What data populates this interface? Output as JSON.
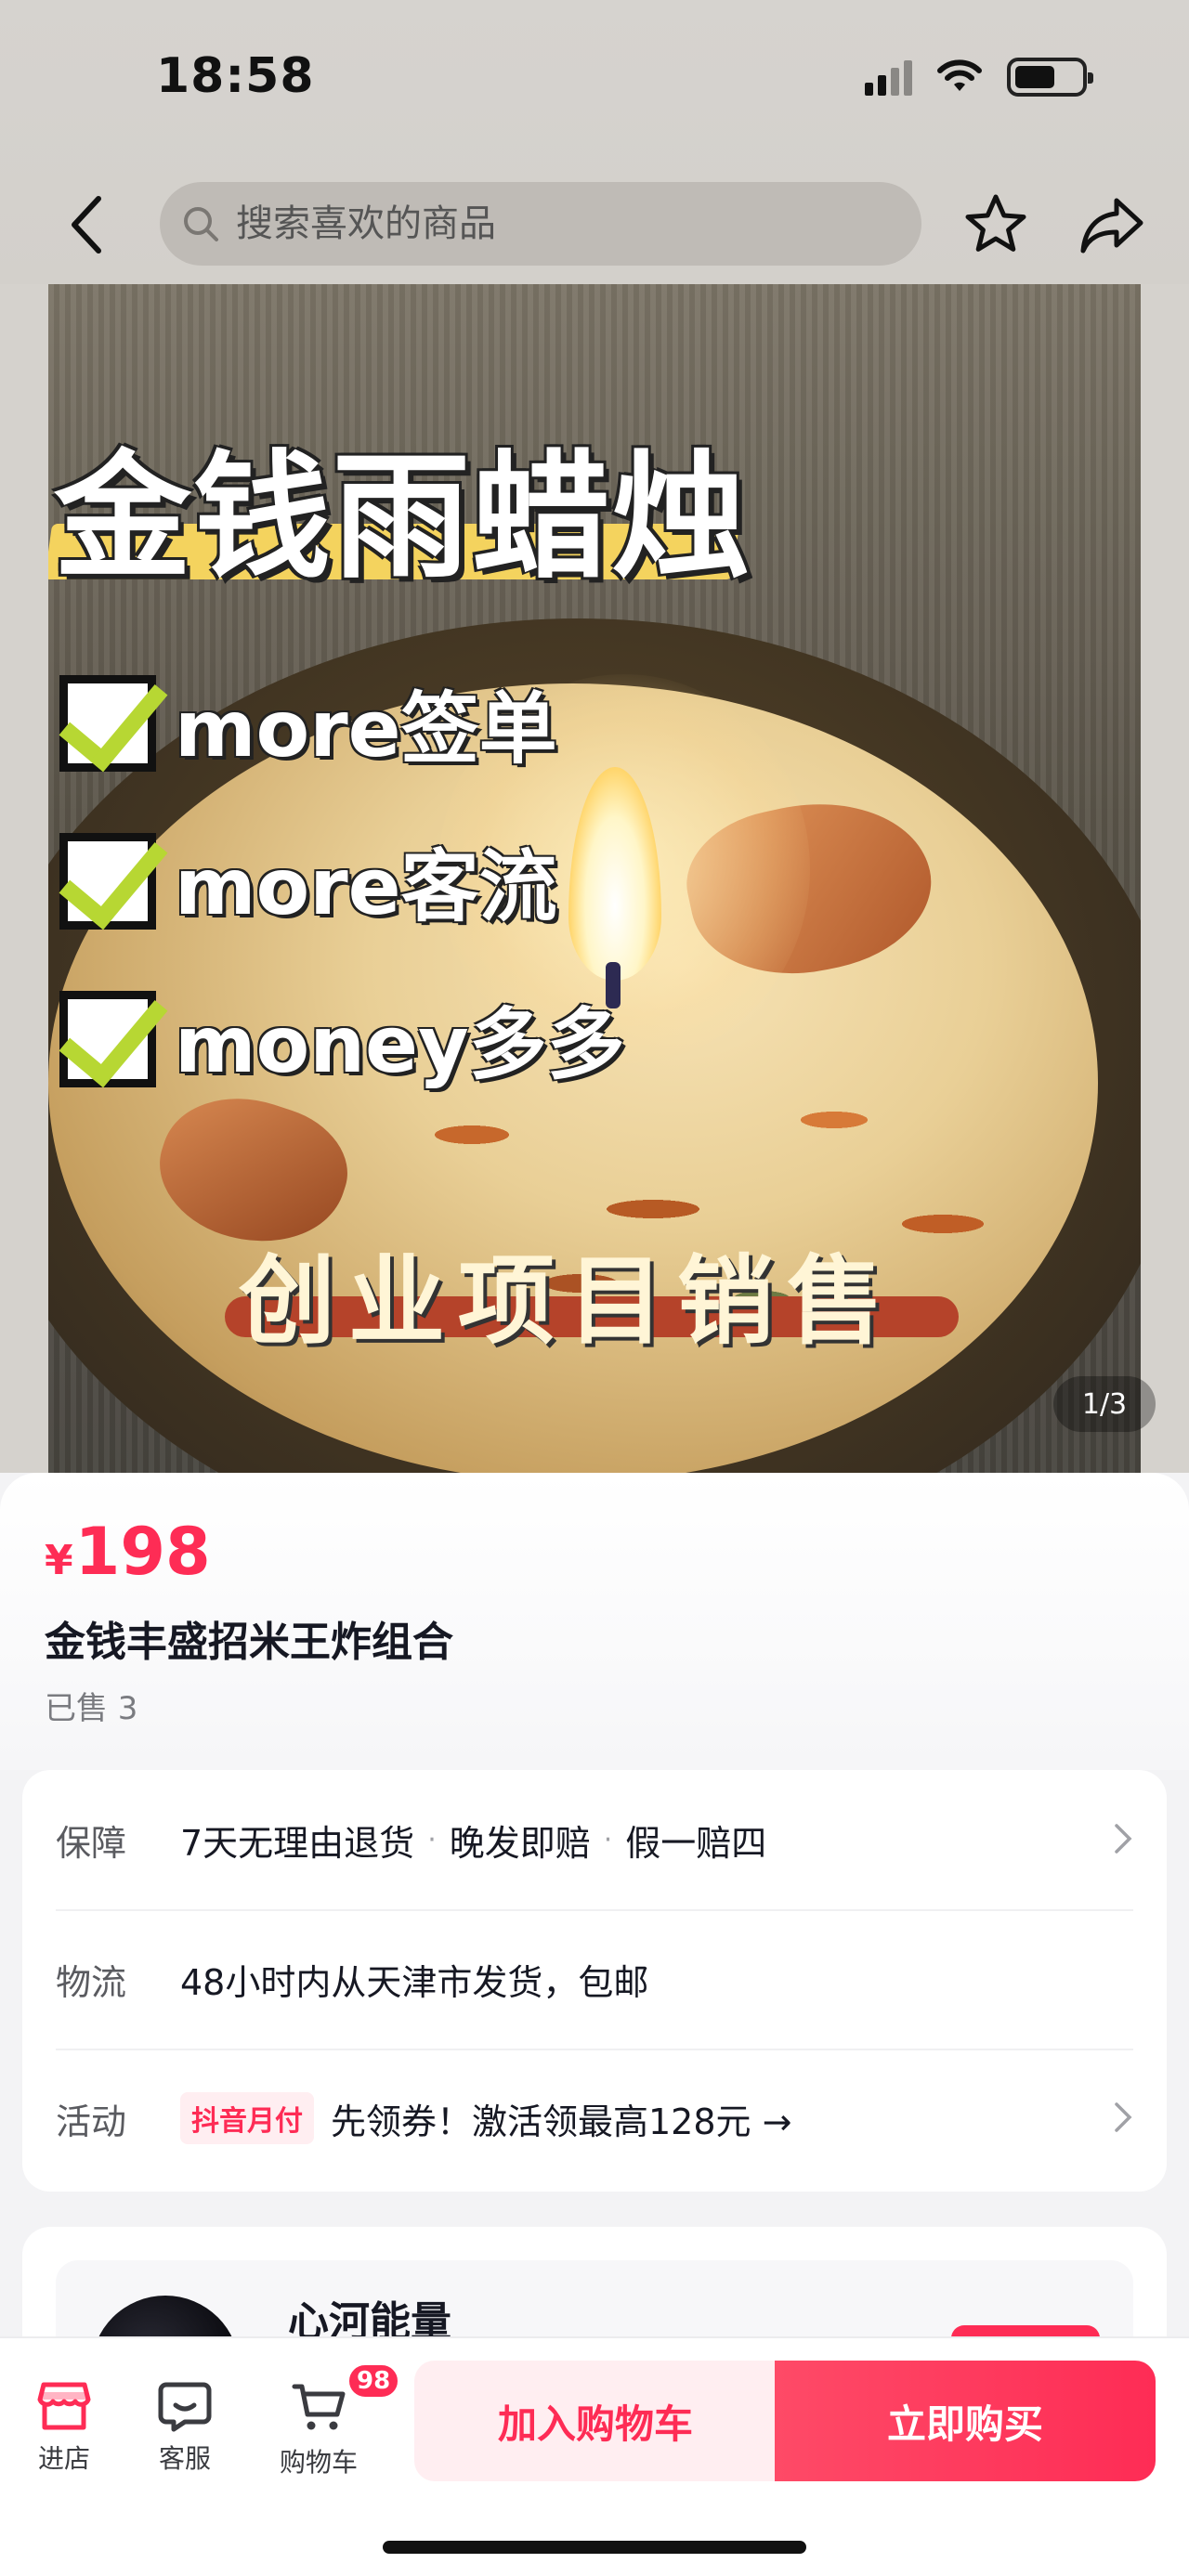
{
  "status_bar": {
    "time": "18:58"
  },
  "nav": {
    "search_placeholder": "搜索喜欢的商品"
  },
  "gallery": {
    "overlay": {
      "title": "金钱雨蜡烛",
      "checks": [
        "more签单",
        "more客流",
        "money多多"
      ],
      "bottom_text": "创业项目销售"
    },
    "page_indicator": "1/3"
  },
  "product": {
    "currency": "¥",
    "price": "198",
    "title": "金钱丰盛招米王炸组合",
    "sold": "已售 3"
  },
  "service": {
    "guarantee": {
      "label": "保障",
      "items": [
        "7天无理由退货",
        "晚发即赔",
        "假一赔四"
      ]
    },
    "logistics": {
      "label": "物流",
      "value": "48小时内从天津市发货，包邮"
    },
    "promotion": {
      "label": "活动",
      "tag": "抖音月付",
      "value": "先领券！激活领最高128元 →"
    }
  },
  "shop": {
    "name": "心河能量"
  },
  "bottom_bar": {
    "store_label": "进店",
    "service_label": "客服",
    "cart_label": "购物车",
    "cart_badge": "98",
    "add_to_cart": "加入购物车",
    "buy_now": "立即购买"
  },
  "colors": {
    "accent": "#fe2c55"
  }
}
